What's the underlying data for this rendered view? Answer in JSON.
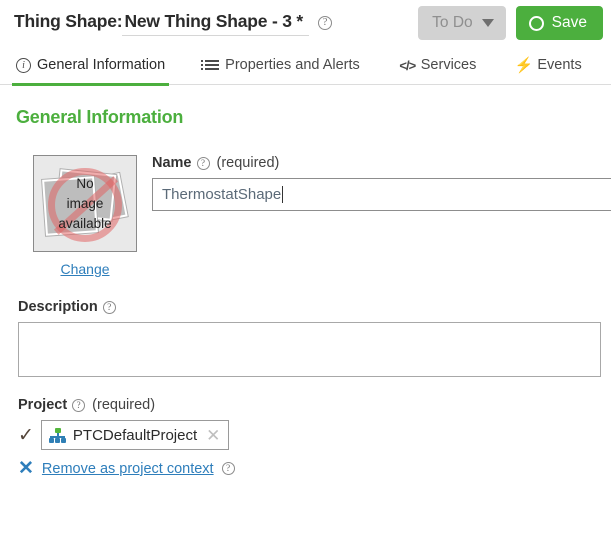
{
  "header": {
    "title_prefix": "Thing Shape:",
    "title_value": "New Thing Shape - 3 *",
    "help_icon": "help-icon",
    "todo_label": "To Do",
    "todo_caret": "chevron-down-icon",
    "save_label": "Save",
    "save_icon": "circle-icon"
  },
  "tabs": [
    {
      "label": "General Information",
      "icon": "info-icon",
      "active": true
    },
    {
      "label": "Properties and Alerts",
      "icon": "list-icon",
      "active": false
    },
    {
      "label": "Services",
      "icon": "code-icon",
      "active": false
    },
    {
      "label": "Events",
      "icon": "lightning-bolt-icon",
      "active": false
    }
  ],
  "main": {
    "section_title": "General Information",
    "image": {
      "placeholder_line1": "No",
      "placeholder_line2": "image",
      "placeholder_line3": "available",
      "change_label": "Change"
    },
    "name_field": {
      "label": "Name",
      "required_text": "(required)",
      "value": "ThermostatShape",
      "help_icon": "help-icon"
    },
    "description_field": {
      "label": "Description",
      "value": "",
      "help_icon": "help-icon"
    },
    "project_field": {
      "label": "Project",
      "required_text": "(required)",
      "help_icon": "help-icon",
      "selected_value": "PTCDefaultProject",
      "project_icon": "hierarchy-icon",
      "clear_icon": "close-icon",
      "check_icon": "checkmark-icon",
      "remove_label": "Remove as project context",
      "remove_icon": "close-icon",
      "remove_help_icon": "help-icon"
    }
  },
  "colors": {
    "brand_green": "#4caf3e",
    "link_blue": "#2e7ebb",
    "todo_gray": "#d2d2d2",
    "text_dark": "#2b2b2b"
  }
}
